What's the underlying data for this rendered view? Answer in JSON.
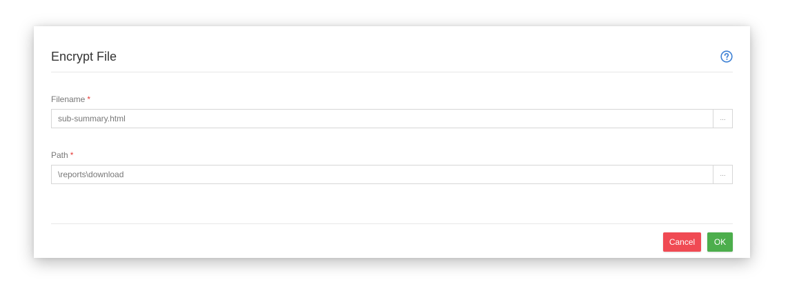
{
  "dialog": {
    "title": "Encrypt File",
    "help_icon": "question-circle-icon"
  },
  "fields": {
    "filename": {
      "label": "Filename",
      "required_marker": "*",
      "value": "sub-summary.html",
      "browse_label": "..."
    },
    "path": {
      "label": "Path",
      "required_marker": "*",
      "value": "\\reports\\download",
      "browse_label": "..."
    }
  },
  "footer": {
    "cancel_label": "Cancel",
    "ok_label": "OK"
  },
  "colors": {
    "help_icon": "#3b7fd4",
    "required": "#e53935",
    "cancel": "#f04a53",
    "ok": "#4cae4c"
  }
}
